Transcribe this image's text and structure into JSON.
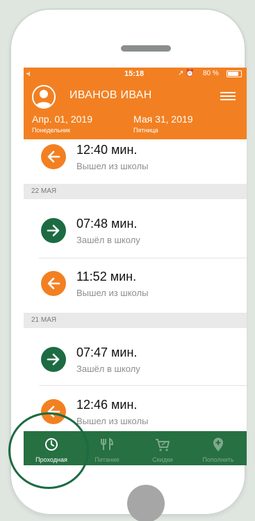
{
  "status_bar": {
    "signal": "•ıl",
    "time": "15:18",
    "icons": "↗ ⏰",
    "battery": "80 %"
  },
  "header": {
    "user_name": "ИВАНОВ ИВАН",
    "date_from": "Апр. 01, 2019",
    "day_from": "Понедельник",
    "date_to": "Мая 31, 2019",
    "day_to": "Пятница"
  },
  "entries": [
    {
      "time": "12:40 мин.",
      "desc": "Вышел из школы",
      "direction": "out"
    },
    {
      "date_header": "22 МАЯ"
    },
    {
      "time": "07:48 мин.",
      "desc": "Зашёл в школу",
      "direction": "in"
    },
    {
      "time": "11:52 мин.",
      "desc": "Вышел из школы",
      "direction": "out"
    },
    {
      "date_header": "21 МАЯ"
    },
    {
      "time": "07:47 мин.",
      "desc": "Зашёл в школу",
      "direction": "in"
    },
    {
      "time": "12:46 мин.",
      "desc": "Вышел из школы",
      "direction": "out"
    }
  ],
  "tabs": [
    {
      "label": "Проходная",
      "icon": "clock-icon",
      "active": true
    },
    {
      "label": "Питание",
      "icon": "fork-knife-icon",
      "active": false
    },
    {
      "label": "Скидки",
      "icon": "discount-cart-icon",
      "active": false
    },
    {
      "label": "Пополнить",
      "icon": "location-plus-icon",
      "active": false
    }
  ],
  "colors": {
    "header": "#f28022",
    "tabbar": "#267042",
    "exit_circle": "#f28022",
    "enter_circle": "#1c6b43",
    "highlight": "#1c6b43"
  }
}
